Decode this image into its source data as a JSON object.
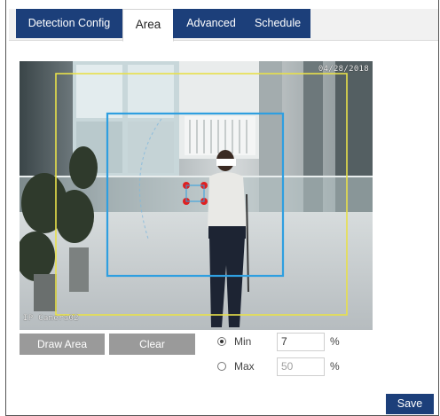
{
  "tabs": [
    {
      "label": "Detection Config"
    },
    {
      "label": "Area"
    },
    {
      "label": "Advanced"
    },
    {
      "label": "Schedule"
    }
  ],
  "active_tab": "Area",
  "video": {
    "timestamp": "04/28/2018",
    "camera_name": "IP Camera02"
  },
  "buttons": {
    "draw_area": "Draw Area",
    "clear": "Clear",
    "save": "Save"
  },
  "size_filter": {
    "selected": "Min",
    "min_label": "Min",
    "min_value": "7",
    "max_label": "Max",
    "max_value": "50",
    "unit": "%"
  },
  "colors": {
    "tab_bg": "#1c3f7a",
    "button_gray": "#9a9a9a",
    "detection_box": "#e8e04a",
    "area_box": "#2f9fe0",
    "target_dots": "#e02020"
  }
}
